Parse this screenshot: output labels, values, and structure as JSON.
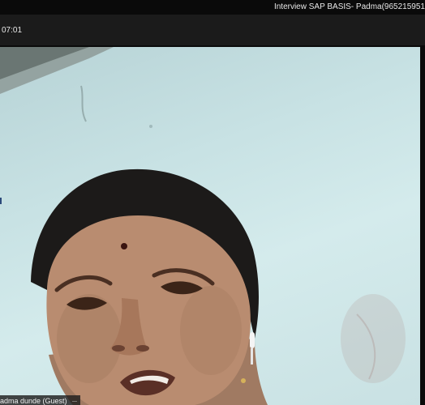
{
  "window": {
    "title": "Interview SAP BASIS- Padma(965215951"
  },
  "toolbar": {
    "call_timer": "07:01"
  },
  "participant": {
    "name_label": "adma dunde (Guest)",
    "more_options_label": "···"
  },
  "colors": {
    "titlebar_bg": "#0a0a0a",
    "toolbar_bg": "#1b1b1b",
    "wall": "#c8e2e4",
    "badge_bg": "#1e1e1e"
  },
  "icons": {
    "more_options": "more-options-icon"
  }
}
